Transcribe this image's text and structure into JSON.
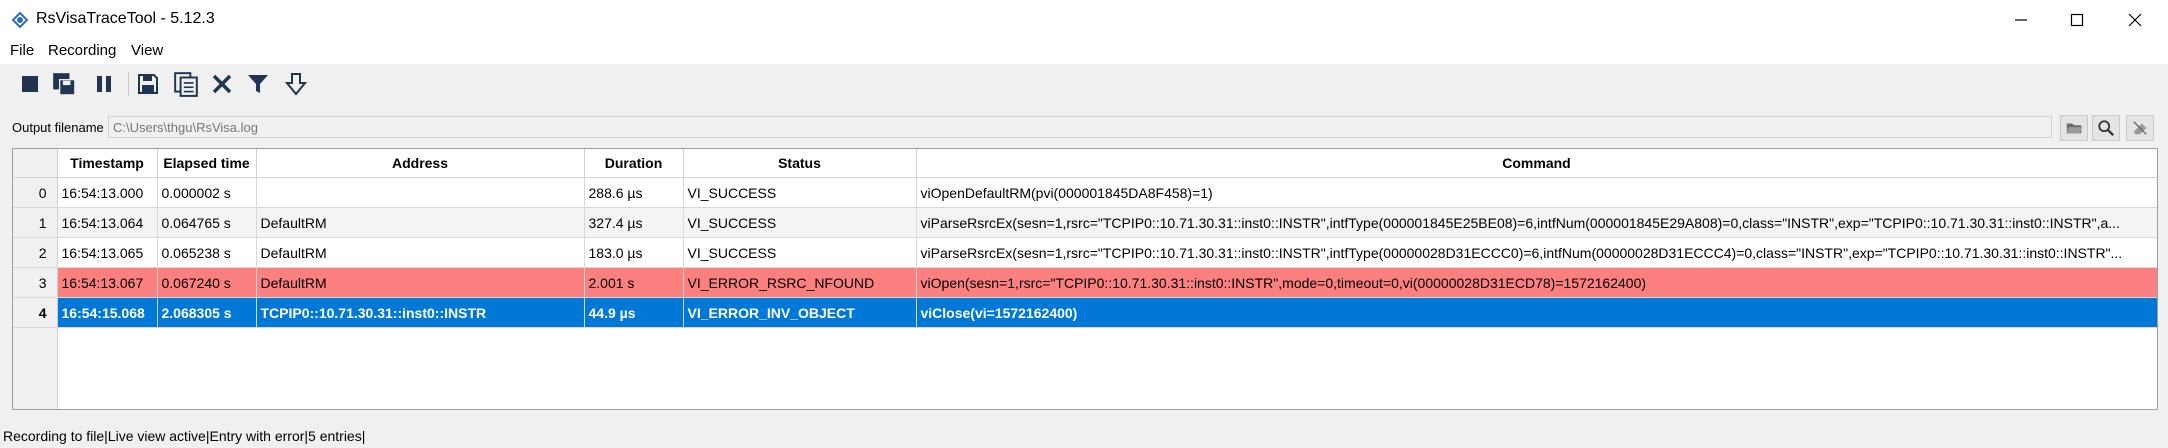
{
  "window": {
    "title": "RsVisaTraceTool - 5.12.3"
  },
  "menu": {
    "items": [
      {
        "label": "File"
      },
      {
        "label": "Recording"
      },
      {
        "label": "View"
      }
    ]
  },
  "toolbar": {
    "buttons": [
      "stop-icon",
      "save-copy-icon",
      "pause-icon",
      "save-icon",
      "copy-icon",
      "clear-icon",
      "filter-icon",
      "scroll-down-icon"
    ]
  },
  "output": {
    "label": "Output filename",
    "value": "C:\\Users\\thgu\\RsVisa.log"
  },
  "grid": {
    "columns": [
      "Timestamp",
      "Elapsed time",
      "Address",
      "Duration",
      "Status",
      "Command"
    ],
    "rows": [
      {
        "index": "0",
        "timestamp": "16:54:13.000",
        "elapsed": "0.000002 s",
        "address": "",
        "duration": "288.6 µs",
        "status": "VI_SUCCESS",
        "command": "viOpenDefaultRM(pvi(000001845DA8F458)=1)"
      },
      {
        "index": "1",
        "timestamp": "16:54:13.064",
        "elapsed": "0.064765 s",
        "address": "DefaultRM",
        "duration": "327.4 µs",
        "status": "VI_SUCCESS",
        "command": "viParseRsrcEx(sesn=1,rsrc=\"TCPIP0::10.71.30.31::inst0::INSTR\",intfType(000001845E25BE08)=6,intfNum(000001845E29A808)=0,class=\"INSTR\",exp=\"TCPIP0::10.71.30.31::inst0::INSTR\",a..."
      },
      {
        "index": "2",
        "timestamp": "16:54:13.065",
        "elapsed": "0.065238 s",
        "address": "DefaultRM",
        "duration": "183.0 µs",
        "status": "VI_SUCCESS",
        "command": "viParseRsrcEx(sesn=1,rsrc=\"TCPIP0::10.71.30.31::inst0::INSTR\",intfType(00000028D31ECCC0)=6,intfNum(00000028D31ECCC4)=0,class=\"INSTR\",exp=\"TCPIP0::10.71.30.31::inst0::INSTR\"..."
      },
      {
        "index": "3",
        "timestamp": "16:54:13.067",
        "elapsed": "0.067240 s",
        "address": "DefaultRM",
        "duration": "2.001 s",
        "status": "VI_ERROR_RSRC_NFOUND",
        "command": "viOpen(sesn=1,rsrc=\"TCPIP0::10.71.30.31::inst0::INSTR\",mode=0,timeout=0,vi(00000028D31ECD78)=1572162400)"
      },
      {
        "index": "4",
        "timestamp": "16:54:15.068",
        "elapsed": "2.068305 s",
        "address": "TCPIP0::10.71.30.31::inst0::INSTR",
        "duration": "44.9 µs",
        "status": "VI_ERROR_INV_OBJECT",
        "command": "viClose(vi=1572162400)"
      }
    ]
  },
  "status_bar": {
    "text": "Recording to file|Live view active|Entry with error|5 entries|"
  },
  "colors": {
    "selected_row": "#0078d7",
    "error_row": "#fc8080",
    "toolbar_icon": "#1f3550"
  }
}
